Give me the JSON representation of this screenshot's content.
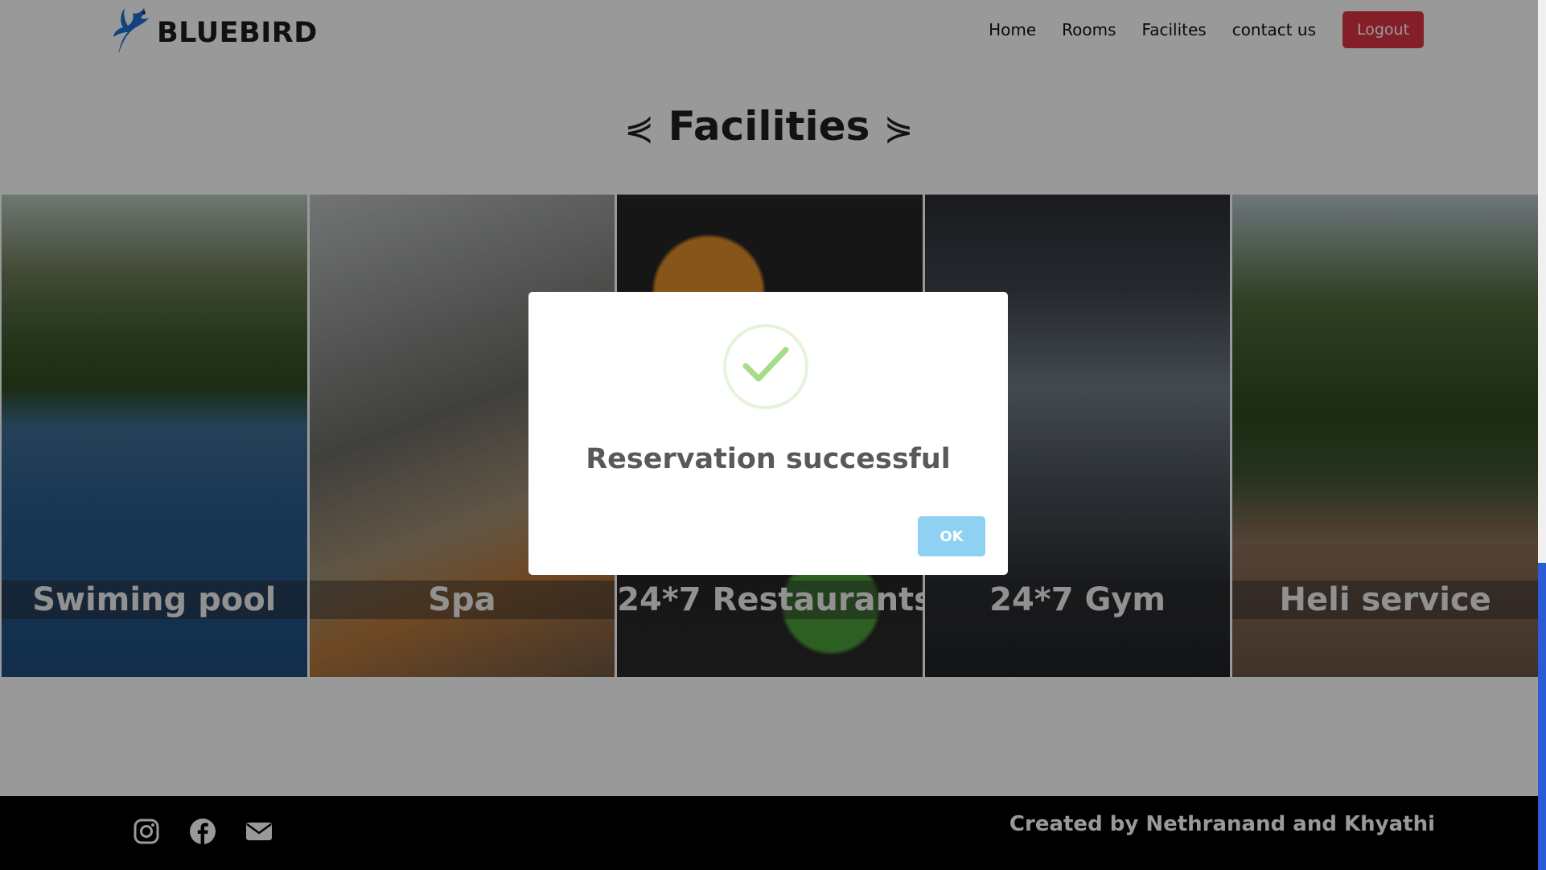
{
  "brand": {
    "name": "BLUEBIRD",
    "logo_icon": "bluebird-logo-icon"
  },
  "nav": {
    "items": [
      {
        "label": "Home"
      },
      {
        "label": "Rooms"
      },
      {
        "label": "Facilites"
      },
      {
        "label": "contact us"
      }
    ],
    "logout_label": "Logout"
  },
  "facilities": {
    "title": "Facilities",
    "ornament_left": "⋞",
    "ornament_right": "⋟",
    "cards": [
      {
        "label": "Swiming pool"
      },
      {
        "label": "Spa"
      },
      {
        "label": "24*7 Restaurants"
      },
      {
        "label": "24*7 Gym"
      },
      {
        "label": "Heli service"
      }
    ]
  },
  "footer": {
    "icons": [
      "instagram-icon",
      "facebook-icon",
      "email-icon"
    ],
    "credits": "Created by Nethranand and Khyathi"
  },
  "modal": {
    "icon": "success-check-icon",
    "title": "Reservation successful",
    "ok_label": "OK"
  },
  "colors": {
    "logout": "#dc3545",
    "ok_button": "#8ed1f3",
    "success_check": "#a5dc86",
    "scrollbar_thumb": "#2b5bd6",
    "footer_bg": "#000000"
  }
}
